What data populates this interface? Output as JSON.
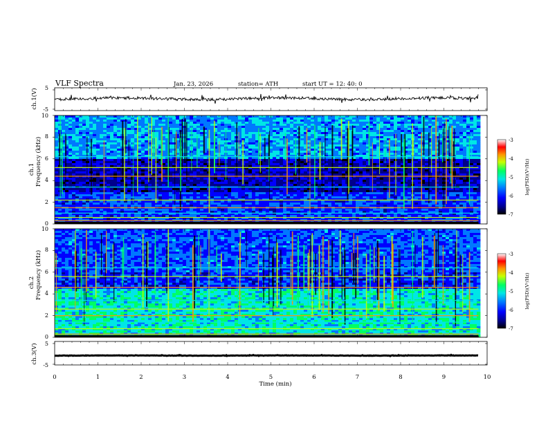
{
  "header": {
    "title": "VLF  Spectra",
    "date": "Jan. 23, 2026",
    "station": "station= ATH",
    "start": "start  UT  =   12: 40: 0"
  },
  "chart_data": [
    {
      "id": "ch1-waveform",
      "type": "line",
      "ylabel": "ch.1(V)",
      "ylim": [
        -5,
        5
      ],
      "yticks": [
        "5",
        "-5"
      ],
      "xlim": [
        0,
        10
      ],
      "color": "#000000",
      "approx_level": 0.2
    },
    {
      "id": "ch1-spectrogram",
      "type": "heatmap",
      "ylabel_line1": "ch.1",
      "ylabel_line2": "Frequency (kHz)",
      "ylim": [
        0,
        10
      ],
      "yticks": [
        "0",
        "2",
        "4",
        "6",
        "8",
        "10"
      ],
      "xlim": [
        0,
        10
      ],
      "data_end_min": 9.8,
      "bands_khz": [
        0.3,
        0.6,
        1.0,
        1.5,
        2.2,
        3.4,
        4.4,
        5.2,
        6.2
      ],
      "colorbar": {
        "label": "log(PSD)(V²/Hz)",
        "range": [
          -7,
          -3
        ],
        "ticks": [
          "-3",
          "-4",
          "-5",
          "-6",
          "-7"
        ]
      }
    },
    {
      "id": "ch2-spectrogram",
      "type": "heatmap",
      "ylabel_line1": "ch.2",
      "ylabel_line2": "Frequency (kHz)",
      "ylim": [
        0,
        10
      ],
      "yticks": [
        "0",
        "2",
        "4",
        "6",
        "8",
        "10"
      ],
      "xlim": [
        0,
        10
      ],
      "data_end_min": 9.8,
      "bands_khz": [
        0.3,
        0.8,
        1.4,
        2.0,
        2.6,
        3.4,
        4.6,
        5.6,
        6.4
      ],
      "colorbar": {
        "label": "log(PSD)(V²/Hz)",
        "range": [
          -7,
          -3
        ],
        "ticks": [
          "-3",
          "-4",
          "-5",
          "-6",
          "-7"
        ]
      }
    },
    {
      "id": "ch3-waveform",
      "type": "line",
      "ylabel": "ch.3(V)",
      "ylim": [
        -5,
        5
      ],
      "yticks": [
        "5",
        "-5"
      ],
      "xlim": [
        0,
        10
      ],
      "xlabel": "Time (min)",
      "xticks": [
        "0",
        "1",
        "2",
        "3",
        "4",
        "5",
        "6",
        "7",
        "8",
        "9",
        "10"
      ],
      "color": "#000000",
      "approx_level": -1
    }
  ],
  "colors": {
    "colormap": [
      "#000000",
      "#00008c",
      "#0000ff",
      "#0078ff",
      "#00e6e6",
      "#00ff64",
      "#c8ff00",
      "#ff9600",
      "#ff0000",
      "#ffffff"
    ]
  }
}
